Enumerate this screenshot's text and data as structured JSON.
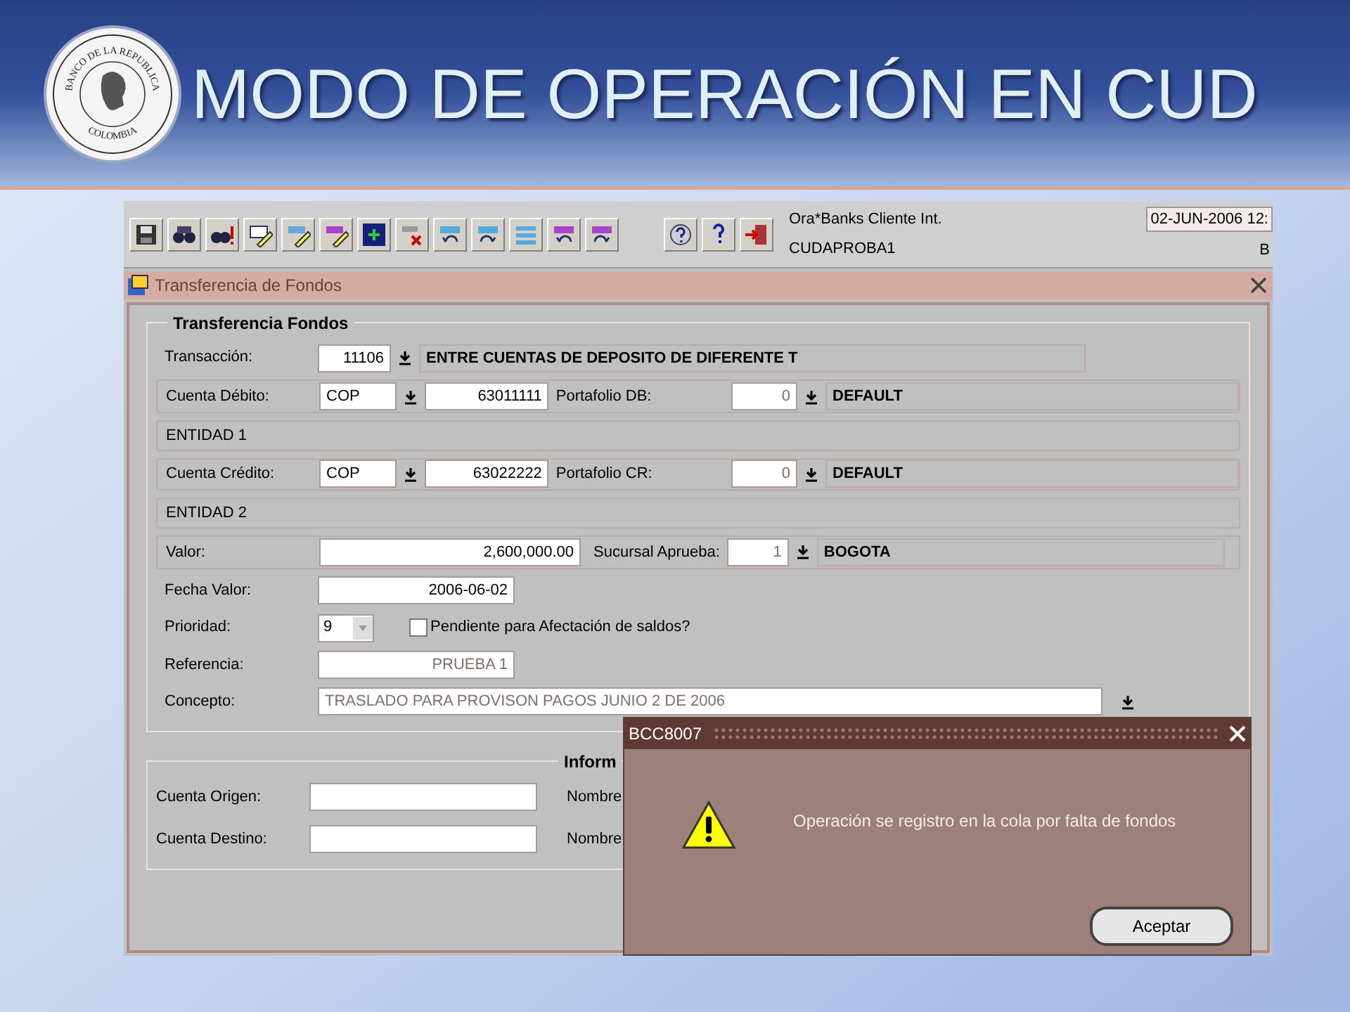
{
  "header": {
    "title": "MODO DE OPERACIÓN EN CUD",
    "seal_top": "BANCO DE LA REPUBLICA",
    "seal_bottom": "COLOMBIA"
  },
  "toolbar": {
    "app_name": "Ora*Banks Cliente Int.",
    "user": "CUDAPROBA1",
    "date": "02-JUN-2006 12:",
    "status": "B"
  },
  "window": {
    "title": "Transferencia de Fondos",
    "section_title": "Transferencia Fondos"
  },
  "form": {
    "transaccion": {
      "label": "Transacción:",
      "code": "11106",
      "description": "ENTRE CUENTAS DE DEPOSITO DE DIFERENTE T"
    },
    "cuenta_debito": {
      "label": "Cuenta Débito:",
      "currency": "COP",
      "account": "63011111",
      "portfolio_label": "Portafolio DB:",
      "portfolio": "0",
      "portfolio_name": "DEFAULT"
    },
    "entidad_1": "ENTIDAD 1",
    "cuenta_credito": {
      "label": "Cuenta Crédito:",
      "currency": "COP",
      "account": "63022222",
      "portfolio_label": "Portafolio CR:",
      "portfolio": "0",
      "portfolio_name": "DEFAULT"
    },
    "entidad_2": "ENTIDAD 2",
    "valor": {
      "label": "Valor:",
      "value": "2,600,000.00",
      "branch_label": "Sucursal Aprueba:",
      "branch": "1",
      "branch_name": "BOGOTA"
    },
    "fecha_valor": {
      "label": "Fecha Valor:",
      "value": "2006-06-02"
    },
    "prioridad": {
      "label": "Prioridad:",
      "value": "9"
    },
    "pendiente": {
      "label": "Pendiente para Afectación de saldos?",
      "checked": false
    },
    "referencia": {
      "label": "Referencia:",
      "value": "PRUEBA 1",
      "disabled": true
    },
    "concepto": {
      "label": "Concepto:",
      "value": "TRASLADO PARA PROVISON PAGOS JUNIO 2 DE 2006",
      "disabled": true
    }
  },
  "info_section": {
    "title": "Inform",
    "rows": [
      {
        "label": "Cuenta Origen:",
        "name_label": "Nombre"
      },
      {
        "label": "Cuenta Destino:",
        "name_label": "Nombre"
      }
    ]
  },
  "dialog": {
    "title": "BCC8007",
    "message": "Operación se registro en la cola por falta de fondos",
    "button": "Aceptar"
  }
}
